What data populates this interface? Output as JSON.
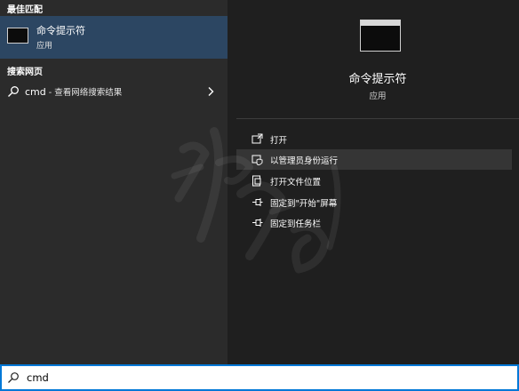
{
  "left_panel": {
    "best_match_header": "最佳匹配",
    "best_match": {
      "title": "命令提示符",
      "subtitle": "应用"
    },
    "web_header": "搜索网页",
    "web_result": {
      "query": "cmd",
      "description": " - 查看网络搜索结果"
    }
  },
  "right_panel": {
    "app_title": "命令提示符",
    "app_subtitle": "应用",
    "actions": [
      {
        "label": "打开",
        "icon": "open-icon"
      },
      {
        "label": "以管理员身份运行",
        "icon": "shield-run-icon",
        "highlighted": true
      },
      {
        "label": "打开文件位置",
        "icon": "file-location-icon"
      },
      {
        "label": "固定到\"开始\"屏幕",
        "icon": "pin-icon"
      },
      {
        "label": "固定到任务栏",
        "icon": "pin-icon"
      }
    ]
  },
  "search_bar": {
    "value": "cmd"
  },
  "colors": {
    "accent": "#0078d7",
    "selection": "#2c4662",
    "left_bg": "#2b2b2b",
    "right_bg": "#1f1f1f"
  }
}
